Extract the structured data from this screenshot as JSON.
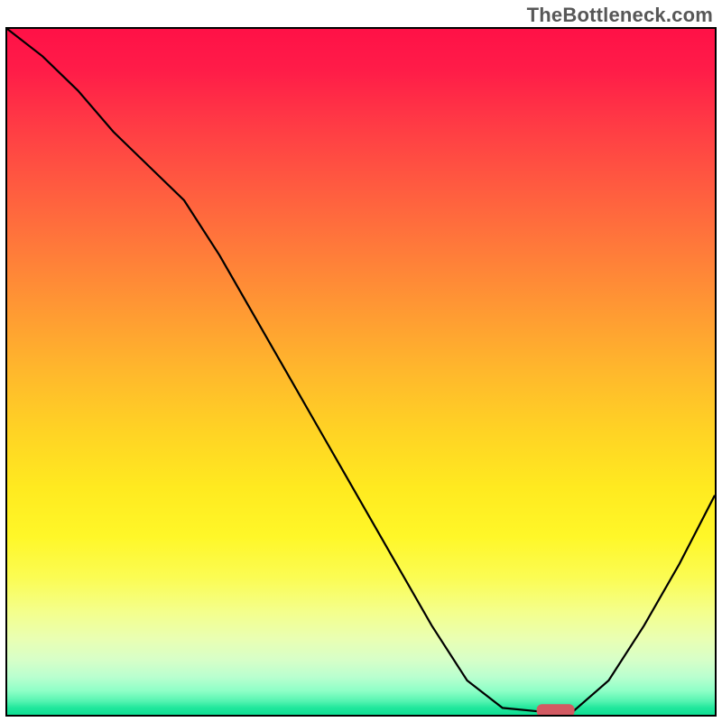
{
  "watermark": "TheBottleneck.com",
  "chart_data": {
    "type": "line",
    "title": "",
    "xlabel": "",
    "ylabel": "",
    "xlim": [
      0,
      100
    ],
    "ylim": [
      0,
      100
    ],
    "series": [
      {
        "name": "bottleneck-curve",
        "x": [
          0,
          5,
          10,
          15,
          20,
          25,
          30,
          35,
          40,
          45,
          50,
          55,
          60,
          65,
          70,
          75,
          80,
          85,
          90,
          95,
          100
        ],
        "y": [
          100,
          96,
          91,
          85,
          80,
          75,
          67,
          58,
          49,
          40,
          31,
          22,
          13,
          5,
          1,
          0.5,
          0.5,
          5,
          13,
          22,
          32
        ]
      }
    ],
    "gradient_stops": [
      {
        "pos": 0,
        "color": "#ff1147"
      },
      {
        "pos": 0.5,
        "color": "#ffb82c"
      },
      {
        "pos": 0.8,
        "color": "#fbfc53"
      },
      {
        "pos": 0.96,
        "color": "#8effc7"
      },
      {
        "pos": 1.0,
        "color": "#0fde93"
      }
    ],
    "marker": {
      "name": "optimal-point",
      "x": 77.5,
      "y": 0.5,
      "color": "#d25a62"
    }
  }
}
